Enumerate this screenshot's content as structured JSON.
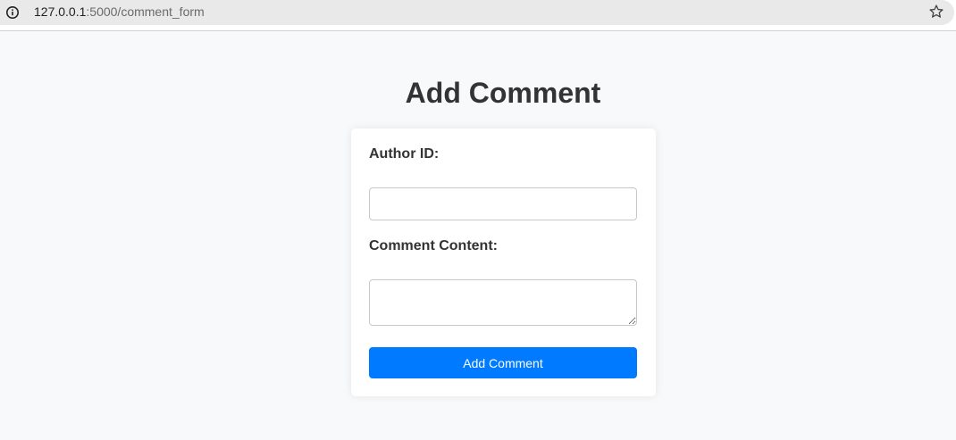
{
  "browser": {
    "url_host": "127.0.0.1",
    "url_rest": ":5000/comment_form",
    "info_icon": "info-icon",
    "bookmark_icon": "star-icon"
  },
  "page": {
    "title": "Add Comment"
  },
  "form": {
    "author_label": "Author ID:",
    "author_value": "",
    "content_label": "Comment Content:",
    "content_value": "",
    "submit_label": "Add Comment"
  },
  "colors": {
    "background": "#f8f9fa",
    "card": "#ffffff",
    "accent": "#007bff",
    "text": "#333333"
  }
}
